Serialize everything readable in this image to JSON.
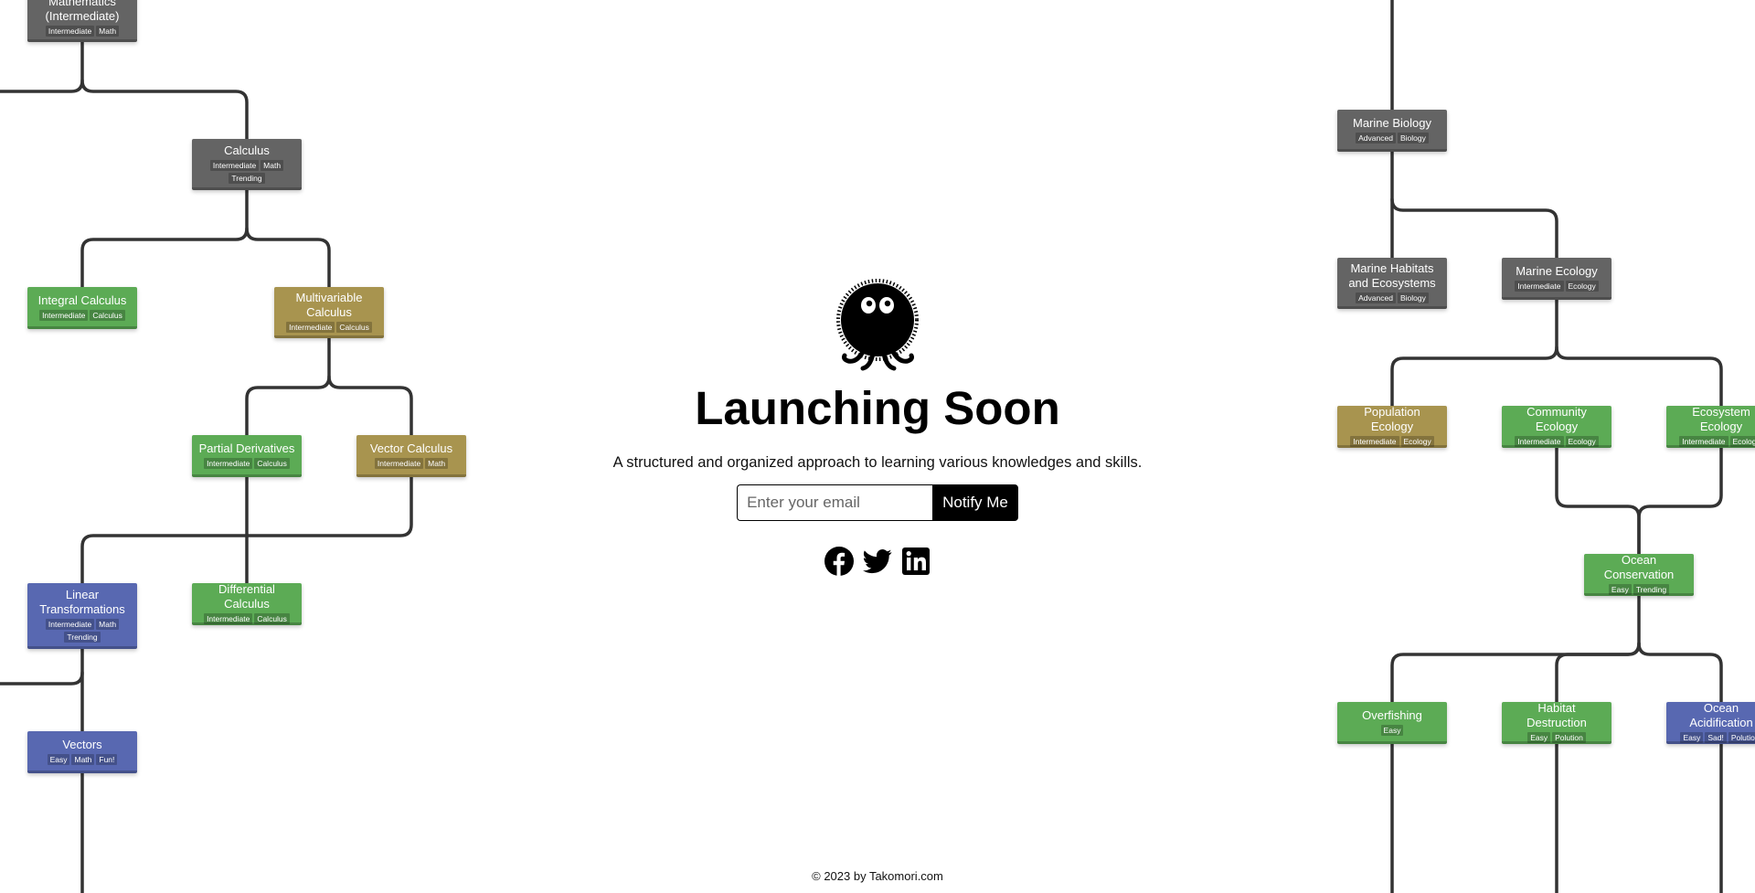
{
  "hero": {
    "headline": "Launching Soon",
    "tagline": "A structured and organized approach to learning various knowledges and skills.",
    "email_placeholder": "Enter your email",
    "email_value": "",
    "notify_label": "Notify Me"
  },
  "social_icons": [
    "facebook-icon",
    "twitter-icon",
    "linkedin-icon"
  ],
  "footer": {
    "copyright": "© 2023 by Takomori.com"
  },
  "colors": {
    "node_gray": "#646464",
    "node_green": "#5cab55",
    "node_gold": "#a8944f",
    "node_blue": "#5868b1",
    "tree_line": "#333333",
    "button": "#000000"
  },
  "tree": {
    "nodes": [
      {
        "id": "mathematics-intermediate",
        "title": "Mathematics (Intermediate)",
        "tags": [
          "Intermediate",
          "Math"
        ],
        "color": "gray"
      },
      {
        "id": "calculus",
        "title": "Calculus",
        "tags": [
          "Intermediate",
          "Math",
          "Trending"
        ],
        "color": "gray"
      },
      {
        "id": "integral-calculus",
        "title": "Integral Calculus",
        "tags": [
          "Intermediate",
          "Calculus"
        ],
        "color": "green"
      },
      {
        "id": "multivariable-calculus",
        "title": "Multivariable Calculus",
        "tags": [
          "Intermediate",
          "Calculus"
        ],
        "color": "gold"
      },
      {
        "id": "partial-derivatives",
        "title": "Partial Derivatives",
        "tags": [
          "Intermediate",
          "Calculus"
        ],
        "color": "green"
      },
      {
        "id": "vector-calculus",
        "title": "Vector Calculus",
        "tags": [
          "Intermediate",
          "Math"
        ],
        "color": "gold"
      },
      {
        "id": "linear-transformations",
        "title": "Linear Transformations",
        "tags": [
          "Intermediate",
          "Math",
          "Trending"
        ],
        "color": "blue"
      },
      {
        "id": "differential-calculus",
        "title": "Differential Calculus",
        "tags": [
          "Intermediate",
          "Calculus"
        ],
        "color": "green"
      },
      {
        "id": "vectors",
        "title": "Vectors",
        "tags": [
          "Easy",
          "Math",
          "Fun!"
        ],
        "color": "blue"
      },
      {
        "id": "marine-biology",
        "title": "Marine Biology",
        "tags": [
          "Advanced",
          "Biology"
        ],
        "color": "gray"
      },
      {
        "id": "marine-habitats",
        "title": "Marine Habitats and Ecosystems",
        "tags": [
          "Advanced",
          "Biology"
        ],
        "color": "gray"
      },
      {
        "id": "marine-ecology",
        "title": "Marine Ecology",
        "tags": [
          "Intermediate",
          "Ecology"
        ],
        "color": "gray"
      },
      {
        "id": "population-ecology",
        "title": "Population Ecology",
        "tags": [
          "Intermediate",
          "Ecology"
        ],
        "color": "gold"
      },
      {
        "id": "community-ecology",
        "title": "Community Ecology",
        "tags": [
          "Intermediate",
          "Ecology"
        ],
        "color": "green"
      },
      {
        "id": "ecosystem-ecology",
        "title": "Ecosystem Ecology",
        "tags": [
          "Intermediate",
          "Ecology"
        ],
        "color": "green"
      },
      {
        "id": "ocean-conservation",
        "title": "Ocean Conservation",
        "tags": [
          "Easy",
          "Trending"
        ],
        "color": "green"
      },
      {
        "id": "overfishing",
        "title": "Overfishing",
        "tags": [
          "Easy"
        ],
        "color": "green"
      },
      {
        "id": "habitat-destruction",
        "title": "Habitat Destruction",
        "tags": [
          "Easy",
          "Polution"
        ],
        "color": "green"
      },
      {
        "id": "ocean-acidification",
        "title": "Ocean Acidification",
        "tags": [
          "Easy",
          "Sad!",
          "Polution"
        ],
        "color": "blue"
      }
    ]
  }
}
